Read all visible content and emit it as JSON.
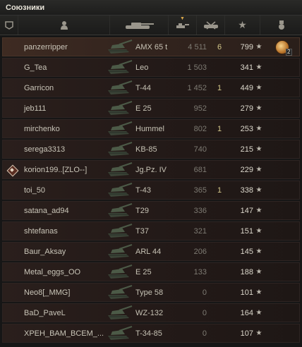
{
  "panel": {
    "title": "Союзники"
  },
  "header": {
    "squad_icon": "squad-icon",
    "player_icon": "player-silhouette-icon",
    "tank_icon": "tank-silhouette-icon",
    "damage_icon": "damage-icon",
    "kills_icon": "destroyed-tanks-icon",
    "xp_icon": "star-icon",
    "medal_icon": "medal-icon"
  },
  "rows": [
    {
      "player": "panzerripper",
      "tank": "AMX 65 t",
      "damage": "4 511",
      "kills": "6",
      "xp": "799",
      "self": true,
      "medal": true,
      "medal_count": "2",
      "squad": false
    },
    {
      "player": "G_Tea",
      "tank": "Leo",
      "damage": "1 503",
      "kills": "",
      "xp": "341",
      "self": false,
      "medal": false,
      "squad": false
    },
    {
      "player": "Garricon",
      "tank": "T-44",
      "damage": "1 452",
      "kills": "1",
      "xp": "449",
      "self": false,
      "medal": false,
      "squad": false
    },
    {
      "player": "jeb111",
      "tank": "E 25",
      "damage": "952",
      "kills": "",
      "xp": "279",
      "self": false,
      "medal": false,
      "squad": false
    },
    {
      "player": "mirchenko",
      "tank": "Hummel",
      "damage": "802",
      "kills": "1",
      "xp": "253",
      "self": false,
      "medal": false,
      "squad": false
    },
    {
      "player": "serega3313",
      "tank": "KB-85",
      "damage": "740",
      "kills": "",
      "xp": "215",
      "self": false,
      "medal": false,
      "squad": false
    },
    {
      "player": "korion199..[ZLO--]",
      "tank": "Jg.Pz. IV",
      "damage": "681",
      "kills": "",
      "xp": "229",
      "self": false,
      "medal": false,
      "squad": true
    },
    {
      "player": "toi_50",
      "tank": "T-43",
      "damage": "365",
      "kills": "1",
      "xp": "338",
      "self": false,
      "medal": false,
      "squad": false
    },
    {
      "player": "satana_ad94",
      "tank": "T29",
      "damage": "336",
      "kills": "",
      "xp": "147",
      "self": false,
      "medal": false,
      "squad": false
    },
    {
      "player": "shtefanas",
      "tank": "T37",
      "damage": "321",
      "kills": "",
      "xp": "151",
      "self": false,
      "medal": false,
      "squad": false
    },
    {
      "player": "Baur_Aksay",
      "tank": "ARL 44",
      "damage": "206",
      "kills": "",
      "xp": "145",
      "self": false,
      "medal": false,
      "squad": false
    },
    {
      "player": "Metal_eggs_OO",
      "tank": "E 25",
      "damage": "133",
      "kills": "",
      "xp": "188",
      "self": false,
      "medal": false,
      "squad": false
    },
    {
      "player": "Neo8[_MMG]",
      "tank": "Type 58",
      "damage": "0",
      "kills": "",
      "xp": "101",
      "self": false,
      "medal": false,
      "squad": false
    },
    {
      "player": "BaD_PaveL",
      "tank": "WZ-132",
      "damage": "0",
      "kills": "",
      "xp": "164",
      "self": false,
      "medal": false,
      "squad": false
    },
    {
      "player": "XPEH_BAM_BCEM_...",
      "tank": "T-34-85",
      "damage": "0",
      "kills": "",
      "xp": "107",
      "self": false,
      "medal": false,
      "squad": false
    }
  ],
  "colors": {
    "accent": "#d7a64a",
    "row_bg": "#2a1f1c",
    "self_row_bg": "#3e2b22",
    "kills": "#d3c78a"
  }
}
